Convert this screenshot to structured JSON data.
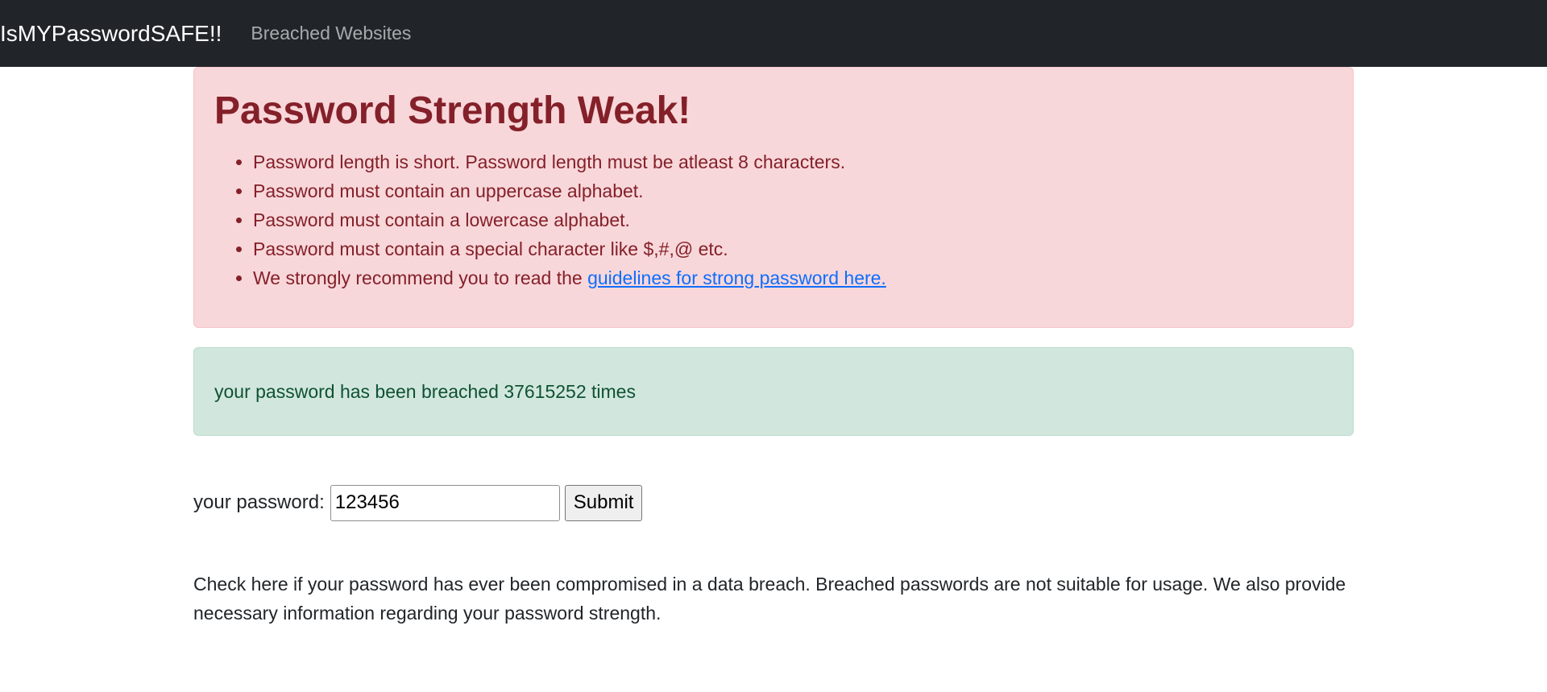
{
  "navbar": {
    "brand": "IsMYPasswordSAFE!!",
    "links": [
      "Breached Websites"
    ]
  },
  "strength_alert": {
    "title": "Password Strength Weak!",
    "items": [
      "Password length is short. Password length must be atleast 8 characters.",
      "Password must contain an uppercase alphabet.",
      "Password must contain a lowercase alphabet.",
      "Password must contain a special character like $,#,@ etc."
    ],
    "recommend_prefix": "We strongly recommend you to read the ",
    "recommend_link": "guidelines for strong password here."
  },
  "breach_alert": {
    "message": "your password has been breached 37615252 times"
  },
  "form": {
    "label": "your password:",
    "value": "123456",
    "submit_label": "Submit"
  },
  "description": "Check here if your password has ever been compromised in a data breach. Breached passwords are not suitable for usage. We also provide necessary information regarding your password strength.",
  "colors": {
    "navbar_bg": "#212529",
    "danger_bg": "#f8d7da",
    "danger_text": "#842029",
    "success_bg": "#d1e7dd",
    "success_text": "#0f5132",
    "link": "#0d6efd"
  }
}
